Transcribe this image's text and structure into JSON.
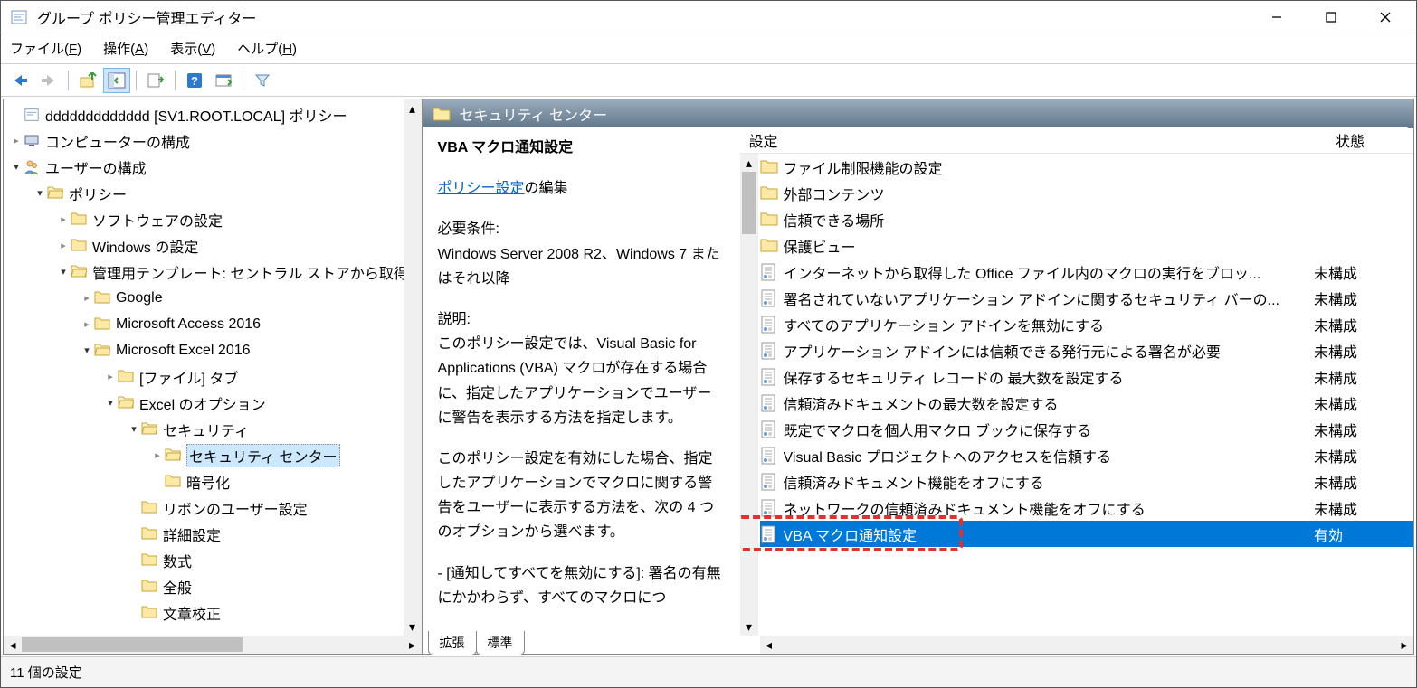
{
  "window": {
    "title": "グループ ポリシー管理エディター"
  },
  "menu": {
    "file": "ファイル(F)",
    "action": "操作(A)",
    "view": "表示(V)",
    "help": "ヘルプ(H)"
  },
  "tree": {
    "root": "ddddddddddddd [SV1.ROOT.LOCAL] ポリシー",
    "computer": "コンピューターの構成",
    "user": "ユーザーの構成",
    "policy": "ポリシー",
    "software": "ソフトウェアの設定",
    "windows": "Windows の設定",
    "admin": "管理用テンプレート: セントラル ストアから取得",
    "google": "Google",
    "access": "Microsoft Access 2016",
    "excel": "Microsoft Excel 2016",
    "filetab": "[ファイル] タブ",
    "excelopt": "Excel のオプション",
    "security": "セキュリティ",
    "seccenter": "セキュリティ センター",
    "crypto": "暗号化",
    "ribbon": "リボンのユーザー設定",
    "detail": "詳細設定",
    "formula": "数式",
    "general": "全般",
    "proof": "文章校正"
  },
  "right": {
    "header": "セキュリティ センター",
    "selected_title": "VBA マクロ通知設定",
    "policy_link": "ポリシー設定",
    "policy_edit_suffix": "の編集",
    "req_label": "必要条件:",
    "req_text": "Windows Server 2008 R2、Windows 7 またはそれ以降",
    "desc_label": "説明:",
    "desc_p1": "このポリシー設定では、Visual Basic for Applications (VBA) マクロが存在する場合に、指定したアプリケーションでユーザーに警告を表示する方法を指定します。",
    "desc_p2": "このポリシー設定を有効にした場合、指定したアプリケーションでマクロに関する警告をユーザーに表示する方法を、次の 4 つのオプションから選べます。",
    "desc_p3": "- [通知してすべてを無効にする]: 署名の有無にかかわらず、すべてのマクロにつ",
    "col_setting": "設定",
    "col_state": "状態",
    "items": [
      {
        "type": "folder",
        "name": "ファイル制限機能の設定",
        "state": ""
      },
      {
        "type": "folder",
        "name": "外部コンテンツ",
        "state": ""
      },
      {
        "type": "folder",
        "name": "信頼できる場所",
        "state": ""
      },
      {
        "type": "folder",
        "name": "保護ビュー",
        "state": ""
      },
      {
        "type": "item",
        "name": "インターネットから取得した Office ファイル内のマクロの実行をブロッ...",
        "state": "未構成"
      },
      {
        "type": "item",
        "name": "署名されていないアプリケーション アドインに関するセキュリティ バーの...",
        "state": "未構成"
      },
      {
        "type": "item",
        "name": "すべてのアプリケーション アドインを無効にする",
        "state": "未構成"
      },
      {
        "type": "item",
        "name": "アプリケーション アドインには信頼できる発行元による署名が必要",
        "state": "未構成"
      },
      {
        "type": "item",
        "name": "保存するセキュリティ レコードの 最大数を設定する",
        "state": "未構成"
      },
      {
        "type": "item",
        "name": "信頼済みドキュメントの最大数を設定する",
        "state": "未構成"
      },
      {
        "type": "item",
        "name": "既定でマクロを個人用マクロ ブックに保存する",
        "state": "未構成"
      },
      {
        "type": "item",
        "name": "Visual Basic プロジェクトへのアクセスを信頼する",
        "state": "未構成"
      },
      {
        "type": "item",
        "name": "信頼済みドキュメント機能をオフにする",
        "state": "未構成"
      },
      {
        "type": "item",
        "name": "ネットワークの信頼済みドキュメント機能をオフにする",
        "state": "未構成"
      },
      {
        "type": "item",
        "name": "VBA マクロ通知設定",
        "state": "有効",
        "selected": true
      }
    ],
    "tab_extended": "拡張",
    "tab_standard": "標準"
  },
  "status": "11 個の設定"
}
